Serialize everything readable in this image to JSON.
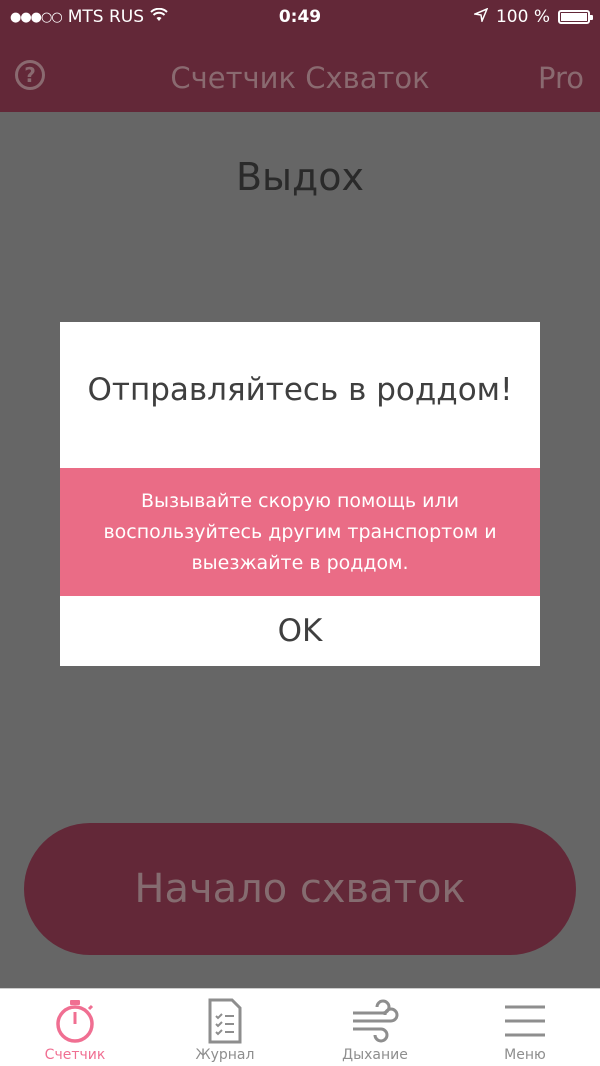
{
  "status_bar": {
    "signal": "●●●○○",
    "carrier": "MTS RUS",
    "time": "0:49",
    "battery": "100 %",
    "battery_level": 1.0
  },
  "header": {
    "help": "?",
    "title": "Счетчик Схваток",
    "pro": "Pro"
  },
  "main": {
    "label": "Выдох",
    "start_button": "Начало схваток"
  },
  "dialog": {
    "title": "Отправляйтесь в роддом!",
    "message": "Вызывайте скорую помощь или воспользуйтесь другим транспортом и выезжайте в роддом.",
    "ok": "OK"
  },
  "tabs": [
    {
      "label": "Счетчик",
      "icon": "stopwatch-icon",
      "active": true
    },
    {
      "label": "Журнал",
      "icon": "journal-icon",
      "active": false
    },
    {
      "label": "Дыхание",
      "icon": "wind-icon",
      "active": false
    },
    {
      "label": "Меню",
      "icon": "menu-icon",
      "active": false
    }
  ],
  "colors": {
    "brand": "#632838",
    "accent": "#f06f92",
    "dialog_message_bg": "#ea6c86"
  }
}
